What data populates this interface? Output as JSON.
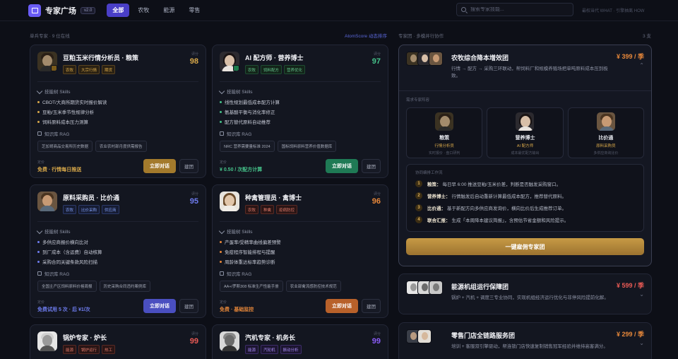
{
  "header": {
    "brand": "专家广场",
    "version": "v2.0",
    "nav": [
      "全部",
      "农牧",
      "能源",
      "零售"
    ],
    "search_placeholder": "搜索专家技能...",
    "hint": "最权当代 WHAT · 引擎抽离 HOW"
  },
  "left_section": {
    "label": "单兵专家 · 9 位在线",
    "sort_label": "AtomScore 动态排序"
  },
  "right_section": {
    "label": "专家团 · 多模并行协作",
    "count": "3 支"
  },
  "colors": {
    "gold": "#d9a94a",
    "blue": "#6f7df0",
    "green": "#45c28a",
    "orange": "#e8883a",
    "red": "#ec5b55",
    "purple": "#8a5cf6"
  },
  "common": {
    "score_label": "评分",
    "skills_label": "技能树 Skills",
    "rag_label": "知识库 RAG",
    "price_label": "定价",
    "resume_label": "建团"
  },
  "experts": [
    {
      "title": "豆粕玉米行情分析员 · 粮策",
      "tags": [
        {
          "t": "农牧",
          "c": "gold"
        },
        {
          "t": "大宗行情",
          "c": "gold"
        },
        {
          "t": "期货",
          "c": "gold"
        }
      ],
      "score": "98",
      "score_color": "gold",
      "skills": [
        "CBOT/大商所期货实时报价解读",
        "豆粕/玉米季节性规律分析",
        "饲料原料成本压力测算"
      ],
      "dot_color": "gold",
      "rag": [
        "芝加哥商品交易所历史数据",
        "农业农村部月度供需报告"
      ],
      "price": "免费 · 行情每日推送",
      "price_color": "gold",
      "chat": "立即对话",
      "chat_color": "gold"
    },
    {
      "title": "AI 配方师 · 营养博士",
      "tags": [
        {
          "t": "农牧",
          "c": "green"
        },
        {
          "t": "饲料配方",
          "c": "green"
        },
        {
          "t": "营养优化",
          "c": "green"
        }
      ],
      "score": "97",
      "score_color": "green",
      "skills": [
        "线性规划最低成本配方计算",
        "氨基酸平衡与消化率修正",
        "配方替代原料自动推荐"
      ],
      "dot_color": "green",
      "rag": [
        "NRC 营养需要量标准 2024",
        "国标饲料原料营养价值数据库"
      ],
      "price": "¥ 0.50 / 次配方计算",
      "price_color": "green",
      "chat": "立即对话",
      "chat_color": "green"
    },
    {
      "title": "原料采购员 · 比价通",
      "tags": [
        {
          "t": "农牧",
          "c": "blue"
        },
        {
          "t": "比价采购",
          "c": "blue"
        },
        {
          "t": "供应商",
          "c": "blue"
        }
      ],
      "score": "95",
      "score_color": "blue",
      "skills": [
        "多供应商报价横向比对",
        "到厂成本（含运费）自动核算",
        "采购合同关键条款风险扫描"
      ],
      "dot_color": "blue",
      "rag": [
        "全国主产区饲料原料价格周报",
        "历史采购合同违约案例库"
      ],
      "price": "免费试用 5 次 · 后 ¥1/次",
      "price_color": "blue",
      "chat": "立即对话",
      "chat_color": "blue"
    },
    {
      "title": "种禽管理员 · 禽博士",
      "tags": [
        {
          "t": "农牧",
          "c": "red"
        },
        {
          "t": "种禽",
          "c": "red"
        },
        {
          "t": "疫病防控",
          "c": "red"
        }
      ],
      "score": "96",
      "score_color": "orange",
      "skills": [
        "产蛋率/受精率曲线偏差预警",
        "免疫程序智能排程与提醒",
        "周龄体重达标率趋势诊断"
      ],
      "dot_color": "orange",
      "rag": [
        "AA+/罗斯308 标准生产性能手册",
        "农业部禽流感防控技术规范"
      ],
      "price": "免费 · 基础监控",
      "price_color": "orange",
      "chat": "立即对话",
      "chat_color": "orange"
    },
    {
      "title": "锅炉专家 · 炉长",
      "tags": [
        {
          "t": "能源",
          "c": "red"
        },
        {
          "t": "锅炉运行",
          "c": "red"
        },
        {
          "t": "热工",
          "c": "red"
        }
      ],
      "score": "99",
      "score_color": "red"
    },
    {
      "title": "汽机专家 · 机务长",
      "tags": [
        {
          "t": "能源",
          "c": "purple"
        },
        {
          "t": "汽轮机",
          "c": "purple"
        },
        {
          "t": "振动分析",
          "c": "purple"
        }
      ],
      "score": "99",
      "score_color": "purple"
    }
  ],
  "teams": [
    {
      "title": "农牧综合降本增效团",
      "desc": "行情 → 配方 → 采购三环联动，帮饲料厂和规模养殖场把单吨原料成本压到极致。",
      "price": "¥ 399 / 季",
      "recs_label": "需求专家阵容",
      "members": [
        {
          "name": "粮策",
          "role": "行情分析员",
          "note": "实时报价 · 盘口研判"
        },
        {
          "name": "营养博士",
          "role": "AI 配方师",
          "note": "成本最优配方输出"
        },
        {
          "name": "比价通",
          "role": "原料采购员",
          "note": "多供应商询比价"
        }
      ],
      "flow_label": "协同编排工作流",
      "steps": [
        {
          "n": "1",
          "k": "粮策：",
          "v": "每日早 6:00 推送豆粕/玉米价差，判断是否触发采购窗口。"
        },
        {
          "n": "2",
          "k": "营养博士：",
          "v": "行情触发后自动重新计算最低成本配方，推荐替代原料。"
        },
        {
          "n": "3",
          "k": "比价通：",
          "v": "基于新配方向多供应商发询价，横向比价后生成推荐订单。"
        },
        {
          "n": "4",
          "k": "联合汇报：",
          "v": "生成「本周降本建议简报」，含预估节省金额和风险提示。"
        }
      ],
      "hire": "一键雇佣专家团"
    },
    {
      "title": "能源机组运行保障团",
      "desc": "锅炉 + 汽机 + 调度三专业协同，实现机组经济运行优化与非停风险提前化解。",
      "price": "¥ 599 / 季"
    },
    {
      "title": "零售门店全链路服务团",
      "desc": "培训 + 客服双引擎驱动，帮连锁门店快速复制销售冠军经验并维持高客满分。",
      "price": "¥ 299 / 季"
    }
  ]
}
